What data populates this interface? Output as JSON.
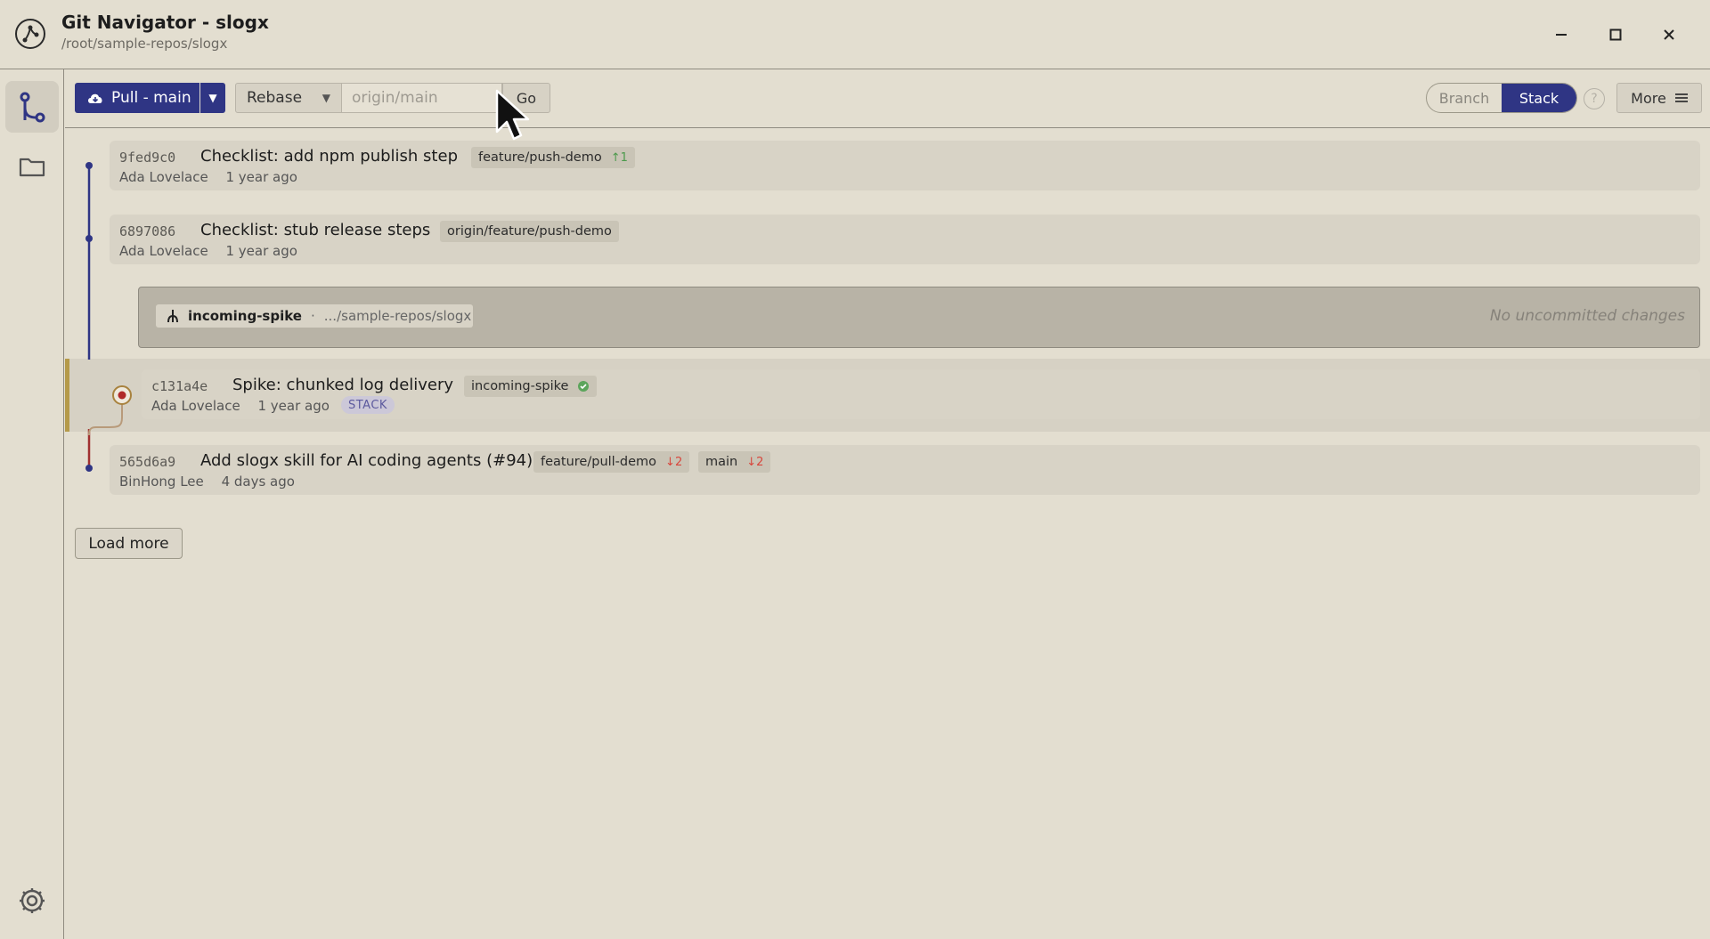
{
  "window": {
    "title": "Git Navigator - slogx",
    "subtitle": "/root/sample-repos/slogx",
    "minimize_icon": "minimize-icon",
    "maximize_icon": "maximize-icon",
    "close_icon": "close-icon"
  },
  "sidebar": {
    "items": [
      {
        "name": "graph",
        "icon": "branch-graph-icon",
        "active": true
      },
      {
        "name": "files",
        "icon": "folder-icon",
        "active": false
      }
    ],
    "settings_icon": "gear-icon"
  },
  "toolbar": {
    "pull_label": "Pull - main",
    "pull_icon": "cloud-download-icon",
    "strategy": "Rebase",
    "target_placeholder": "origin/main",
    "go_label": "Go",
    "mode_options": [
      "Branch",
      "Stack"
    ],
    "mode_selected": "Stack",
    "help_label": "?",
    "more_label": "More"
  },
  "commits": [
    {
      "sha": "9fed9c0",
      "subject": "Checklist: add npm publish step",
      "author": "Ada Lovelace",
      "date": "1 year ago",
      "refs": [
        {
          "name": "feature/push-demo",
          "ahead": "↑1"
        }
      ]
    },
    {
      "sha": "6897086",
      "subject": "Checklist: stub release steps",
      "author": "Ada Lovelace",
      "date": "1 year ago",
      "refs": [
        {
          "name": "origin/feature/push-demo"
        }
      ]
    },
    {
      "sha": "c131a4e",
      "subject": "Spike: chunked log delivery",
      "author": "Ada Lovelace",
      "date": "1 year ago",
      "badge": "STACK",
      "refs": [
        {
          "name": "incoming-spike",
          "status": "check-circle-icon"
        }
      ]
    },
    {
      "sha": "565d6a9",
      "subject": "Add slogx skill for AI coding agents (#94)",
      "author": "BinHong Lee",
      "date": "4 days ago",
      "refs": [
        {
          "name": "feature/pull-demo",
          "behind": "↓2"
        },
        {
          "name": "main",
          "behind": "↓2"
        }
      ]
    }
  ],
  "worktree": {
    "branch": "incoming-spike",
    "separator": "·",
    "path": ".../sample-repos/slogx",
    "status": "No uncommitted changes",
    "icon": "fork-icon"
  },
  "load_more_label": "Load more",
  "colors": {
    "accent": "#2f3584",
    "background": "#e3ded0",
    "row": "#d8d3c6",
    "graph_blue": "#2f3584",
    "graph_red": "#a03030",
    "stack_marker": "#b59a4a",
    "ahead": "#4c9a4c",
    "behind": "#d8463c"
  }
}
